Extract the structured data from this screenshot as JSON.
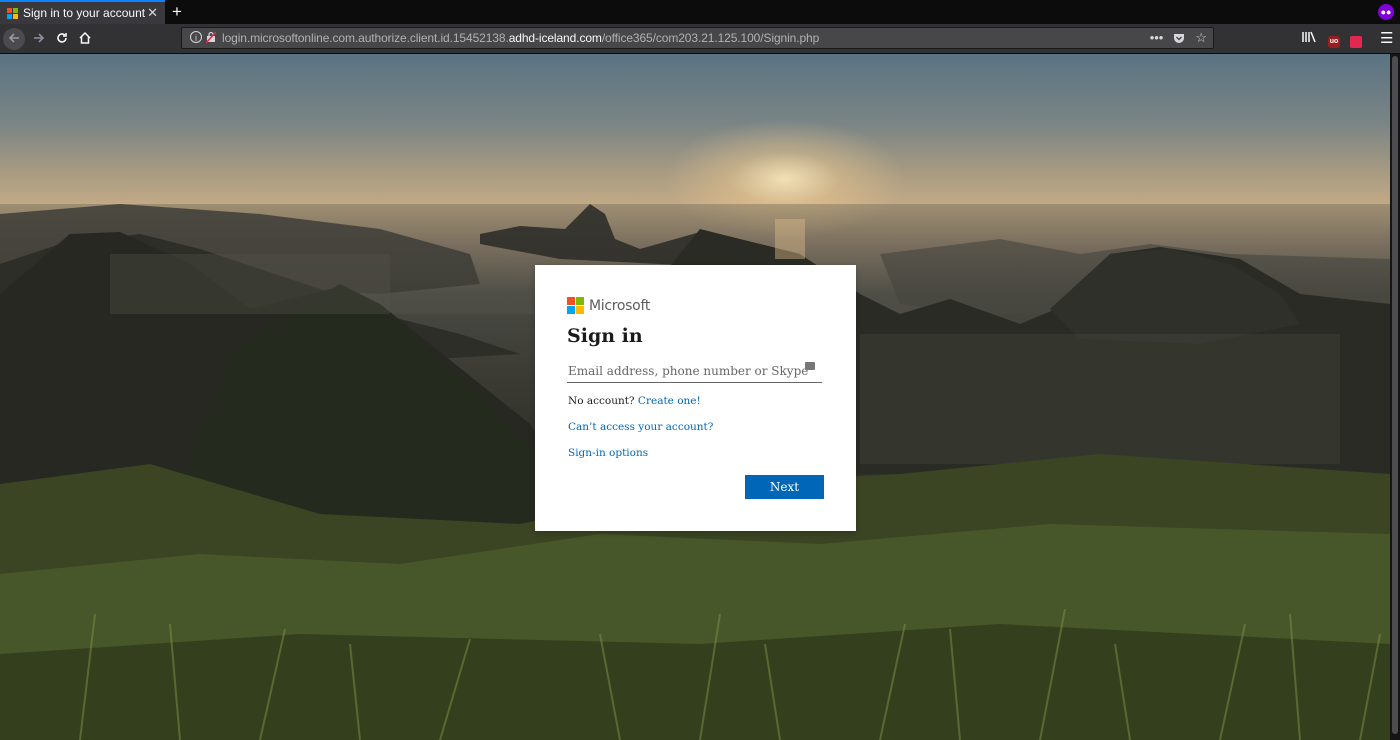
{
  "browser": {
    "tab": {
      "title": "Sign in to your account",
      "close_glyph": "✕"
    },
    "new_tab_glyph": "+",
    "url": {
      "prefix": "login.microsoftonline.com.authorize.client.id.15452138.",
      "host": "adhd-iceland.com",
      "path": "/office365/com203.21.125.100/Signin.php"
    },
    "icons": [
      "private-browsing-mask-icon",
      "back-arrow-icon",
      "forward-arrow-icon",
      "reload-icon",
      "home-icon",
      "site-info-icon",
      "insecure-lock-icon",
      "page-actions-icon",
      "pocket-icon",
      "bookmark-star-icon",
      "library-icon",
      "ublock-icon",
      "extension-icon",
      "hamburger-menu-icon"
    ]
  },
  "signin": {
    "brand": "Microsoft",
    "title": "Sign in",
    "email_placeholder": "Email address, phone number or Skype",
    "no_account_text": "No account?",
    "create_link": "Create one!",
    "cant_access_link": "Can’t access your account?",
    "options_link": "Sign-in options",
    "next_label": "Next",
    "logo_colors": [
      "#f25022",
      "#7fba00",
      "#00a4ef",
      "#ffb900"
    ]
  },
  "colors": {
    "accent": "#0067b8",
    "tab_highlight": "#0a84ff"
  }
}
